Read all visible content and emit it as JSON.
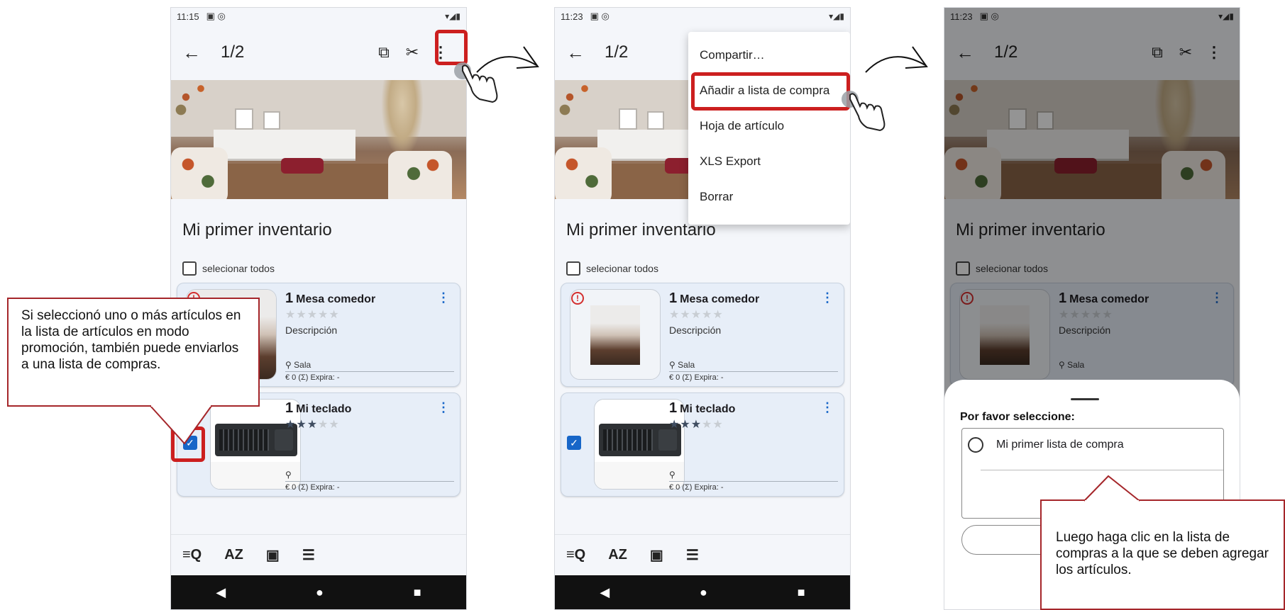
{
  "phones": [
    {
      "status_time": "11:15",
      "appbar_title": "1/2",
      "inventory_title": "Mi primer inventario",
      "select_all_label": "selecionar todos",
      "items": [
        {
          "qty": "1",
          "name": "Mesa comedor",
          "stars": 0,
          "description": "Descripción",
          "location": "Sala",
          "meta": "€ 0  (Σ)  Expira: -",
          "checked": false
        },
        {
          "qty": "1",
          "name": "Mi teclado",
          "stars": 3,
          "description": "",
          "location": "",
          "meta": "€ 0  (Σ)  Expira: -",
          "checked": true
        }
      ]
    },
    {
      "status_time": "11:23",
      "appbar_title": "1/2",
      "inventory_title": "Mi primer inventario",
      "select_all_label": "selecionar todos",
      "items": [
        {
          "qty": "1",
          "name": "Mesa comedor",
          "stars": 0,
          "description": "Descripción",
          "location": "Sala",
          "meta": "€ 0  (Σ)  Expira: -",
          "checked": false
        },
        {
          "qty": "1",
          "name": "Mi teclado",
          "stars": 3,
          "description": "",
          "location": "",
          "meta": "€ 0  (Σ)  Expira: -",
          "checked": true
        }
      ],
      "menu": [
        "Compartir…",
        "Añadir a lista de compra",
        "Hoja de artículo",
        "XLS Export",
        "Borrar"
      ]
    },
    {
      "status_time": "11:23",
      "appbar_title": "1/2",
      "inventory_title": "Mi primer inventario",
      "select_all_label": "selecionar todos",
      "items": [
        {
          "qty": "1",
          "name": "Mesa comedor",
          "stars": 0,
          "description": "Descripción",
          "location": "Sala"
        }
      ],
      "sheet": {
        "prompt": "Por favor seleccione:",
        "option": "Mi primer lista de compra"
      }
    }
  ],
  "callouts": {
    "left": "Si seleccionó uno o más artículos en la lista de artículos en modo promoción, también puede enviarlos a una lista de compras.",
    "right": "Luego haga clic en la lista de compras a la que se deben agregar los artículos."
  },
  "icons": {
    "back": "←",
    "copy": "⧉",
    "cut": "✂",
    "more": "⋮",
    "alert": "!",
    "pin": "⚲",
    "check": "✓",
    "nav_back": "◀",
    "nav_home": "●",
    "nav_recent": "■",
    "bottom": [
      "≡Q",
      "AZ",
      "▣",
      "☰"
    ]
  },
  "colors": {
    "highlight": "#cc1f1f",
    "accent": "#1766c8",
    "callout_border": "#a5262a"
  }
}
